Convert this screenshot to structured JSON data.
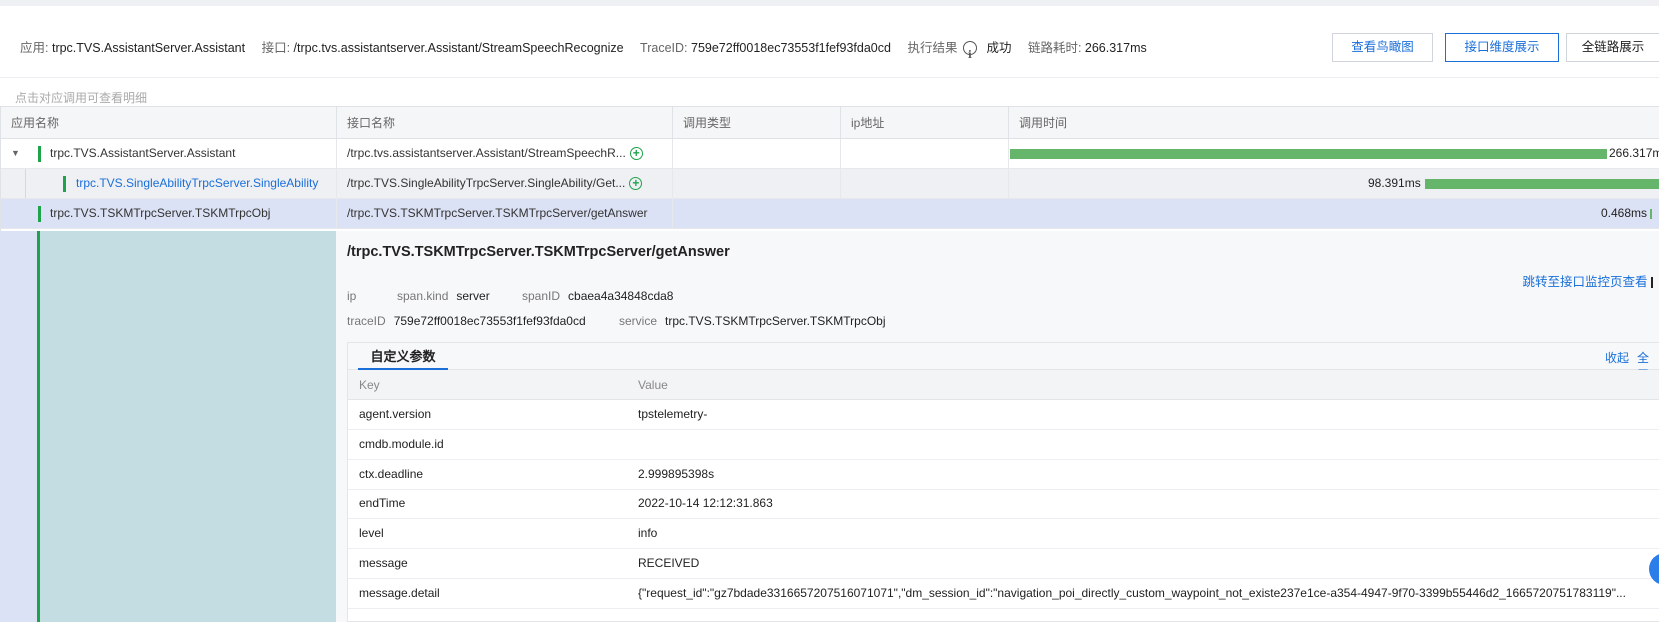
{
  "header": {
    "app_label": "应用:",
    "app_value": "trpc.TVS.AssistantServer.Assistant",
    "iface_label": "接口:",
    "iface_value": "/trpc.tvs.assistantserver.Assistant/StreamSpeechRecognize",
    "trace_label": "TraceID:",
    "trace_value": "759e72ff0018ec73553f1fef93fda0cd",
    "result_label": "执行结果",
    "result_value": "成功",
    "latency_label": "链路耗时:",
    "latency_value": "266.317ms",
    "btn_birdseye": "查看鸟瞰图",
    "btn_interface_dim": "接口维度展示",
    "btn_full_chain": "全链路展示"
  },
  "hint": "点击对应调用可查看明细",
  "table": {
    "columns": [
      "应用名称",
      "接口名称",
      "调用类型",
      "ip地址",
      "调用时间"
    ],
    "rows": [
      {
        "app": "trpc.TVS.AssistantServer.Assistant",
        "iface": "/trpc.tvs.assistantserver.Assistant/StreamSpeechR...",
        "call_type": "",
        "ip": "",
        "duration": "266.317m",
        "duration_fraction": 1.0
      },
      {
        "app": "trpc.TVS.SingleAbilityTrpcServer.SingleAbility",
        "iface": "/trpc.TVS.SingleAbilityTrpcServer.SingleAbility/Get...",
        "call_type": "",
        "ip": "",
        "duration": "98.391ms",
        "duration_fraction": 0.369
      },
      {
        "app": "trpc.TVS.TSKMTrpcServer.TSKMTrpcObj",
        "iface": "/trpc.TVS.TSKMTrpcServer.TSKMTrpcServer/getAnswer",
        "call_type": "",
        "ip": "",
        "duration": "0.468ms",
        "duration_fraction": 0.002
      }
    ]
  },
  "detail": {
    "title": "/trpc.TVS.TSKMTrpcServer.TSKMTrpcServer/getAnswer",
    "monitor_link": "跳转至接口监控页查看",
    "ip_label": "ip",
    "ip_value": "",
    "kind_label": "span.kind",
    "kind_value": "server",
    "spanid_label": "spanID",
    "spanid_value": "cbaea4a34848cda8",
    "traceid_label": "traceID",
    "traceid_value": "759e72ff0018ec73553f1fef93fda0cd",
    "service_label": "service",
    "service_value": "trpc.TVS.TSKMTrpcServer.TSKMTrpcObj",
    "params_tab": "自定义参数",
    "collapse": "收起",
    "fullscreen": "全屏",
    "col_key": "Key",
    "col_value": "Value",
    "params": [
      {
        "key": "agent.version",
        "value": "tpstelemetry-"
      },
      {
        "key": "cmdb.module.id",
        "value": ""
      },
      {
        "key": "ctx.deadline",
        "value": "2.999895398s"
      },
      {
        "key": "endTime",
        "value": "2022-10-14 12:12:31.863"
      },
      {
        "key": "level",
        "value": "info"
      },
      {
        "key": "message",
        "value": "RECEIVED"
      },
      {
        "key": "message.detail",
        "value": "{\"request_id\":\"gz7bdade3316657207516071071\",\"dm_session_id\":\"navigation_poi_directly_custom_waypoint_not_existe237e1ce-a354-4947-9f70-3399b55446d2_1665720751783119\"..."
      }
    ]
  }
}
